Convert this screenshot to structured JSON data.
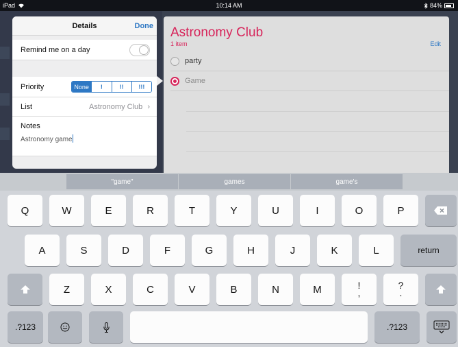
{
  "status_bar": {
    "device": "iPad",
    "time": "10:14 AM",
    "battery": "84%",
    "battery_level": 0.84
  },
  "list": {
    "title": "Astronomy Club",
    "count": "1 item",
    "edit_label": "Edit",
    "items": [
      {
        "text": "party",
        "checked": false
      },
      {
        "text": "Game",
        "checked": true
      }
    ]
  },
  "popover": {
    "title": "Details",
    "done_label": "Done",
    "remind_label": "Remind me on a day",
    "priority_label": "Priority",
    "priority_options": [
      "None",
      "!",
      "!!",
      "!!!"
    ],
    "priority_selected": "None",
    "list_label": "List",
    "list_value": "Astronomy Club",
    "notes_label": "Notes",
    "notes_value": "Astronomy game"
  },
  "keyboard": {
    "suggestions": [
      "\"game\"",
      "games",
      "game's"
    ],
    "row1": [
      "Q",
      "W",
      "E",
      "R",
      "T",
      "Y",
      "U",
      "I",
      "O",
      "P"
    ],
    "row2": [
      "A",
      "S",
      "D",
      "F",
      "G",
      "H",
      "J",
      "K",
      "L"
    ],
    "return_label": "return",
    "row3": [
      "Z",
      "X",
      "C",
      "V",
      "B",
      "N",
      "M"
    ],
    "punct1": [
      "!",
      ","
    ],
    "punct2": [
      "?",
      "."
    ],
    "numbers_label": ".?123"
  },
  "colors": {
    "accent_red": "#d7245a",
    "accent_blue": "#2e78c4"
  }
}
